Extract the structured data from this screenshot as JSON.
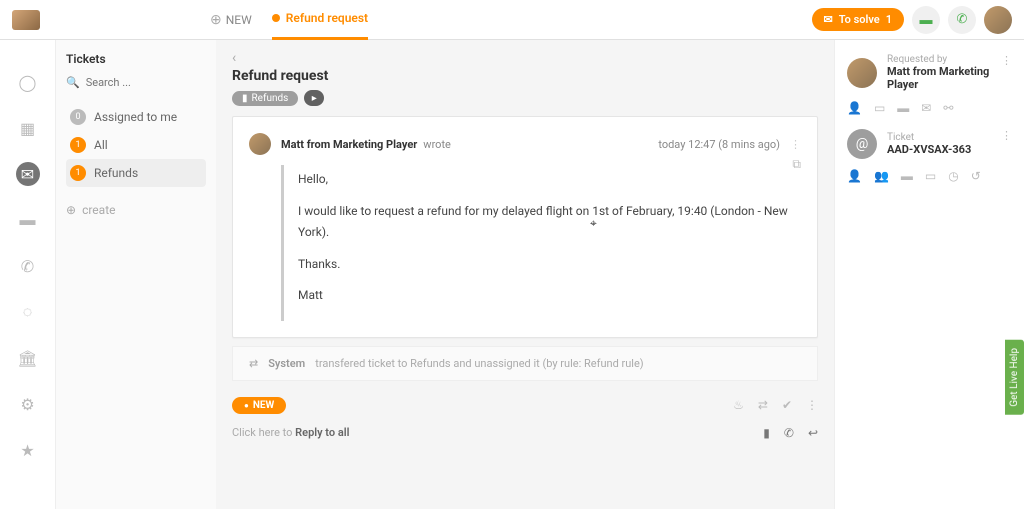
{
  "top": {
    "new_tab": "NEW",
    "active_tab": "Refund request",
    "solve_label": "To solve",
    "solve_count": "1"
  },
  "tickets": {
    "heading": "Tickets",
    "search_placeholder": "Search ...",
    "filters": [
      {
        "count": "0",
        "label": "Assigned to me",
        "orange": false
      },
      {
        "count": "1",
        "label": "All",
        "orange": true
      },
      {
        "count": "1",
        "label": "Refunds",
        "orange": true
      }
    ],
    "create": "create"
  },
  "page": {
    "title": "Refund request",
    "tag": "Refunds"
  },
  "message": {
    "author": "Matt from Marketing Player",
    "verb": "wrote",
    "timestamp": "today 12:47 (8 mins ago)",
    "lines": {
      "l1": "Hello,",
      "l2": "I would like to request a refund for my delayed flight on 1st of February, 19:40 (London - New York).",
      "l3": "Thanks.",
      "l4": "Matt"
    }
  },
  "system": {
    "label": "System",
    "text": "transfered ticket to Refunds and unassigned it (by rule: Refund rule)"
  },
  "status": {
    "new": "NEW"
  },
  "reply": {
    "prefix": "Click here to ",
    "action": "Reply to all"
  },
  "right": {
    "requested_label": "Requested by",
    "requester": "Matt from Marketing Player",
    "ticket_label": "Ticket",
    "ticket_id": "AAD-XVSAX-363"
  },
  "live_help": "Get Live Help"
}
